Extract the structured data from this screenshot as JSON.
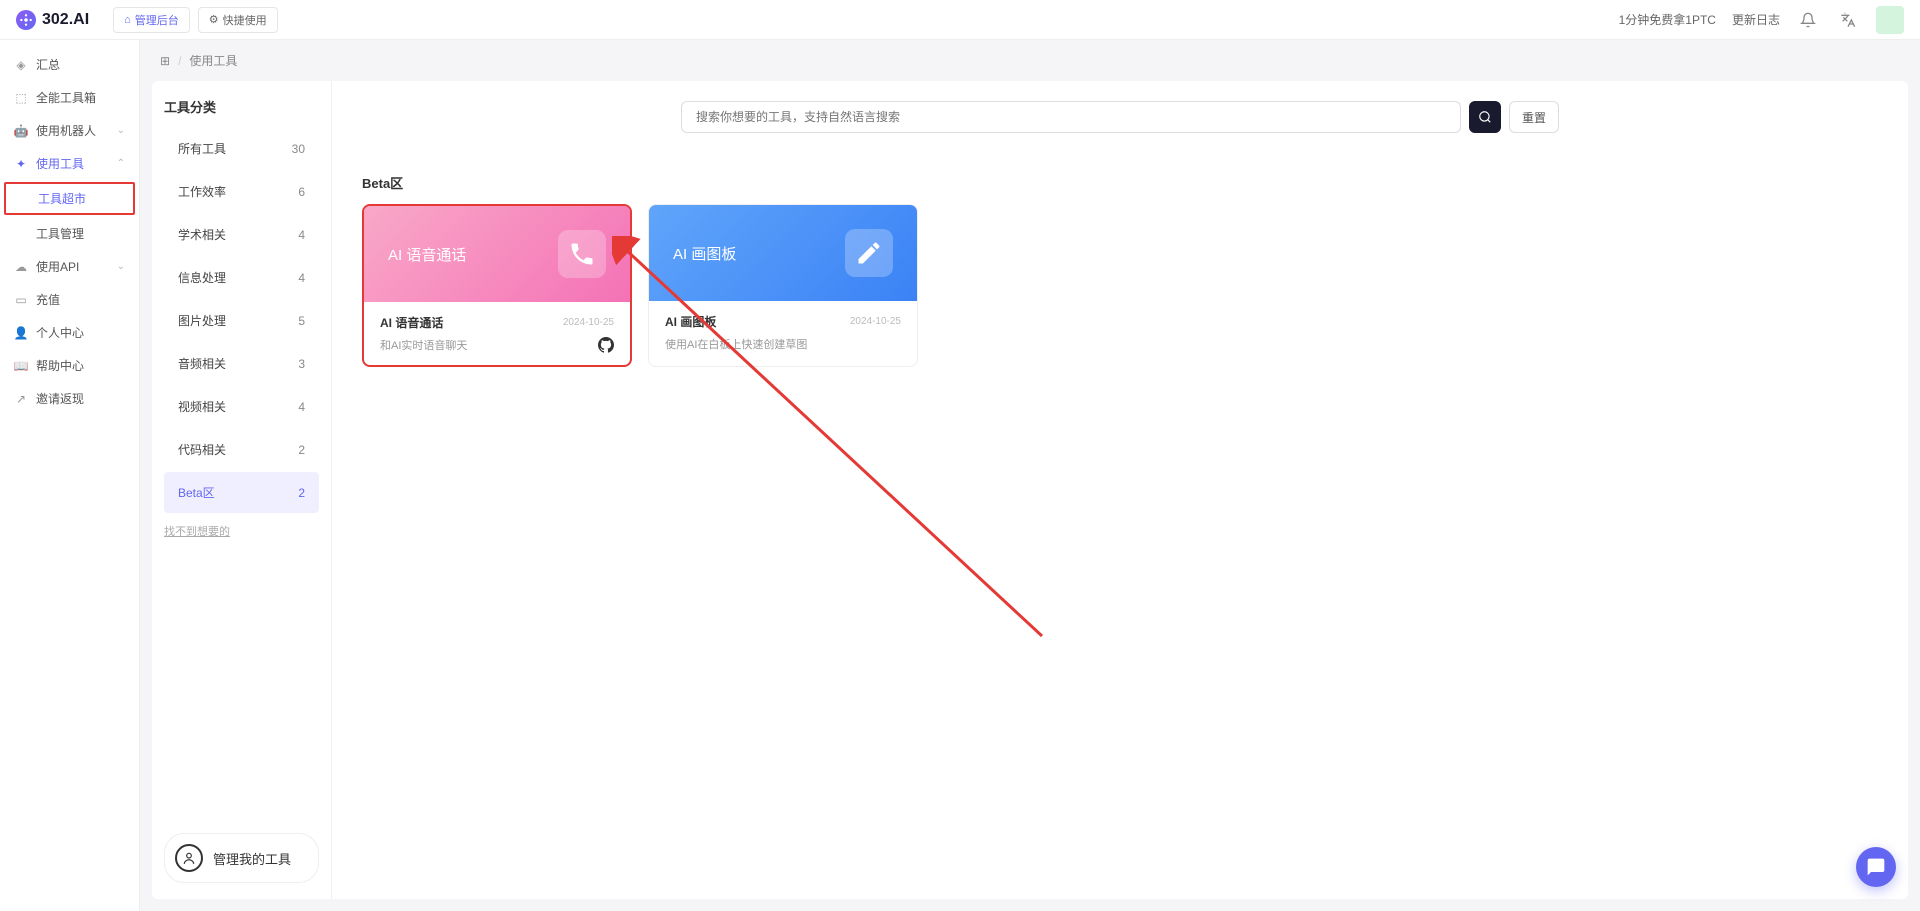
{
  "header": {
    "logo_text": "302.AI",
    "admin_btn": "管理后台",
    "quick_btn": "快捷使用",
    "promo": "1分钟免费拿1PTC",
    "changelog": "更新日志"
  },
  "sidebar": {
    "items": [
      {
        "label": "汇总",
        "icon": "dashboard"
      },
      {
        "label": "全能工具箱",
        "icon": "box"
      },
      {
        "label": "使用机器人",
        "icon": "robot",
        "expandable": true
      },
      {
        "label": "使用工具",
        "icon": "tool",
        "expandable": true,
        "expanded": true,
        "active": true
      },
      {
        "label": "使用API",
        "icon": "cloud",
        "expandable": true
      },
      {
        "label": "充值",
        "icon": "card"
      },
      {
        "label": "个人中心",
        "icon": "user"
      },
      {
        "label": "帮助中心",
        "icon": "help"
      },
      {
        "label": "邀请返现",
        "icon": "share"
      }
    ],
    "sub_items": [
      {
        "label": "工具超市",
        "highlighted": true
      },
      {
        "label": "工具管理"
      }
    ]
  },
  "breadcrumb": {
    "current": "使用工具"
  },
  "categories": {
    "title": "工具分类",
    "items": [
      {
        "label": "所有工具",
        "count": 30
      },
      {
        "label": "工作效率",
        "count": 6
      },
      {
        "label": "学术相关",
        "count": 4
      },
      {
        "label": "信息处理",
        "count": 4
      },
      {
        "label": "图片处理",
        "count": 5
      },
      {
        "label": "音频相关",
        "count": 3
      },
      {
        "label": "视频相关",
        "count": 4
      },
      {
        "label": "代码相关",
        "count": 2
      },
      {
        "label": "Beta区",
        "count": 2,
        "active": true
      }
    ],
    "link": "找不到想要的",
    "footer": "管理我的工具"
  },
  "search": {
    "placeholder": "搜索你想要的工具，支持自然语言搜索",
    "reset": "重置"
  },
  "section": {
    "title": "Beta区"
  },
  "cards": [
    {
      "hero_title": "AI 语音通话",
      "title": "AI 语音通话",
      "date": "2024-10-25",
      "desc": "和AI实时语音聊天",
      "color": "pink",
      "highlighted": true,
      "github": true
    },
    {
      "hero_title": "AI 画图板",
      "title": "AI 画图板",
      "date": "2024-10-25",
      "desc": "使用AI在白板上快速创建草图",
      "color": "blue",
      "highlighted": false,
      "github": false
    }
  ]
}
